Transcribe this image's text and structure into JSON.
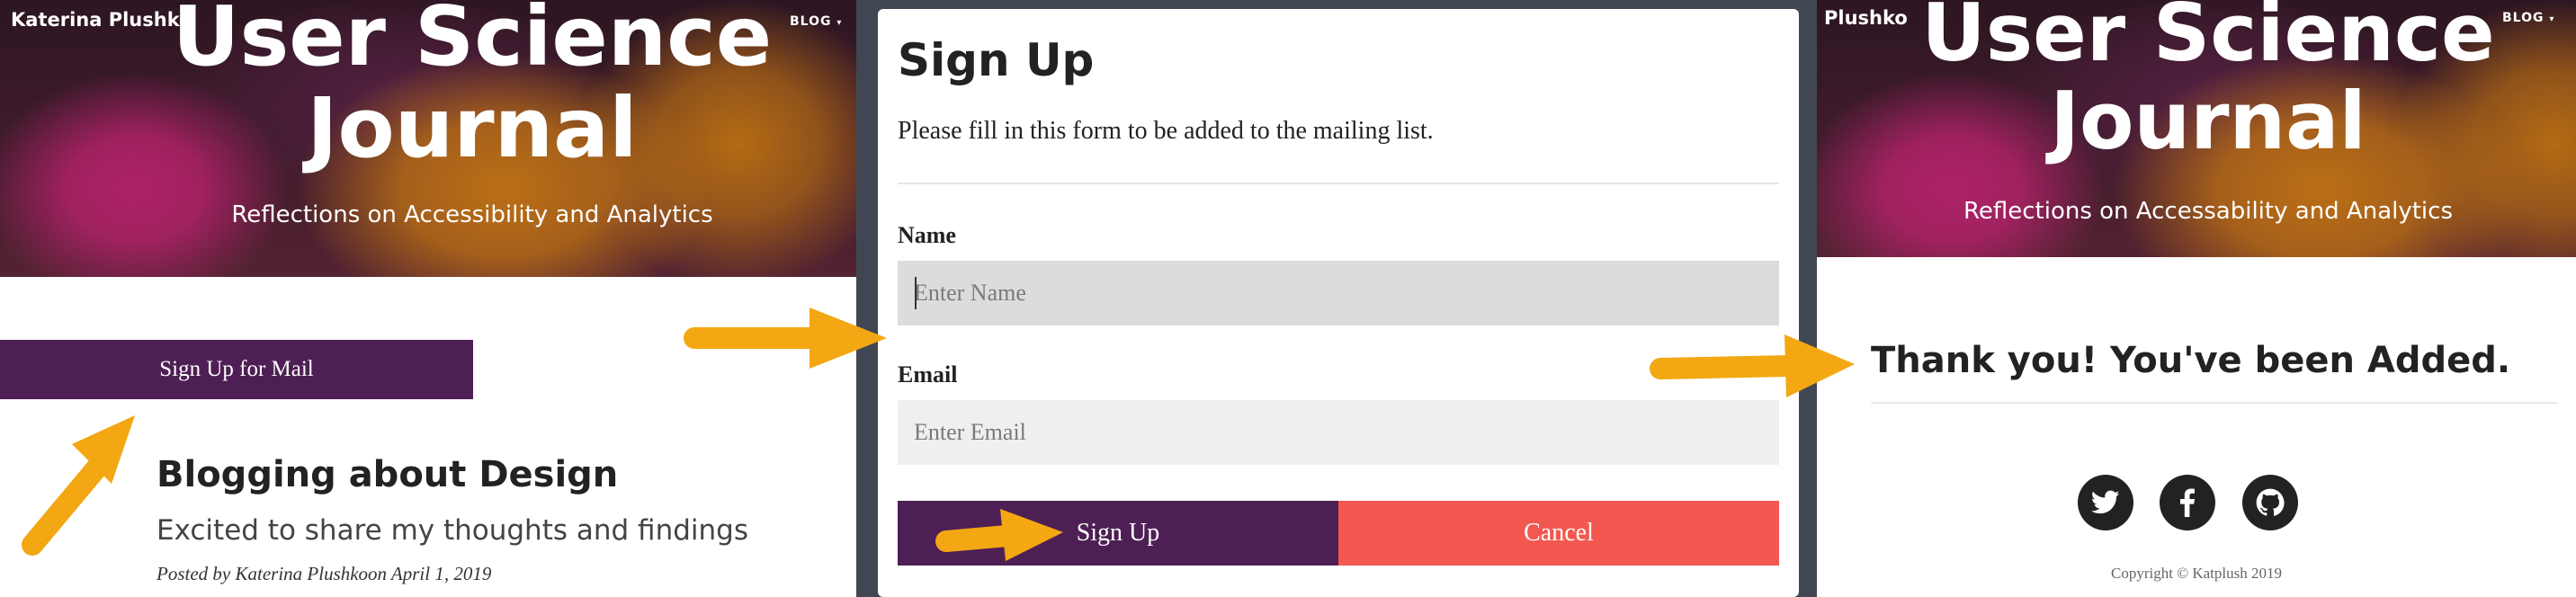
{
  "site": {
    "brand": "Katerina Plushko",
    "brand_partial": "Plushko",
    "blog_nav": "BLOG",
    "title_line1": "User Science",
    "title_line2": "Journal",
    "subtitle_left": "Reflections on Accessibility and Analytics",
    "subtitle_right": "Reflections on Accessability and Analytics"
  },
  "home": {
    "mail_button": "Sign Up for Mail",
    "post_title": "Blogging about Design",
    "post_subtitle": "Excited to share my thoughts and findings",
    "post_meta_prefix": "Posted by ",
    "post_author": "Katerina Plushkoon",
    "post_date": " April 1, 2019"
  },
  "modal": {
    "title": "Sign Up",
    "description": "Please fill in this form to be added to the mailing list.",
    "name_label": "Name",
    "name_placeholder": "Enter Name",
    "email_label": "Email",
    "email_placeholder": "Enter Email",
    "signup_button": "Sign Up",
    "cancel_button": "Cancel"
  },
  "confirmation": {
    "message": "Thank you! You've been Added.",
    "social": [
      {
        "icon": "twitter-icon"
      },
      {
        "icon": "facebook-icon"
      },
      {
        "icon": "github-icon"
      }
    ],
    "copyright": "Copyright © Katplush 2019"
  },
  "colors": {
    "primary_purple": "#4e1f55",
    "cancel_red": "#f2584f",
    "arrow_orange": "#f3a712",
    "modal_backdrop": "#414752"
  }
}
